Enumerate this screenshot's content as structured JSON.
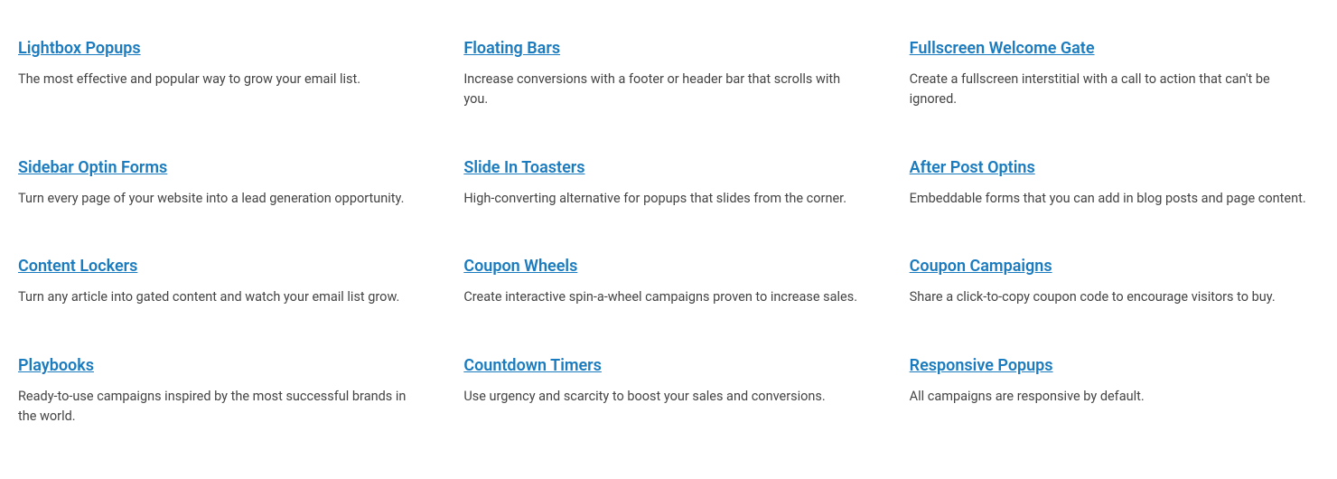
{
  "items": [
    {
      "title": "Lightbox Popups",
      "description": "The most effective and popular way to grow your email list."
    },
    {
      "title": "Floating Bars",
      "description": "Increase conversions with a footer or header bar that scrolls with you."
    },
    {
      "title": "Fullscreen Welcome Gate",
      "description": "Create a fullscreen interstitial with a call to action that can't be ignored."
    },
    {
      "title": "Sidebar Optin Forms",
      "description": "Turn every page of your website into a lead generation opportunity."
    },
    {
      "title": "Slide In Toasters",
      "description": "High-converting alternative for popups that slides from the corner."
    },
    {
      "title": "After Post Optins",
      "description": "Embeddable forms that you can add in blog posts and page content."
    },
    {
      "title": "Content Lockers",
      "description": "Turn any article into gated content and watch your email list grow."
    },
    {
      "title": "Coupon Wheels",
      "description": "Create interactive spin-a-wheel campaigns proven to increase sales."
    },
    {
      "title": "Coupon Campaigns",
      "description": "Share a click-to-copy coupon code to encourage visitors to buy."
    },
    {
      "title": "Playbooks",
      "description": "Ready-to-use campaigns inspired by the most successful brands in the world."
    },
    {
      "title": "Countdown Timers",
      "description": "Use urgency and scarcity to boost your sales and conversions."
    },
    {
      "title": "Responsive Popups",
      "description": "All campaigns are responsive by default."
    }
  ]
}
